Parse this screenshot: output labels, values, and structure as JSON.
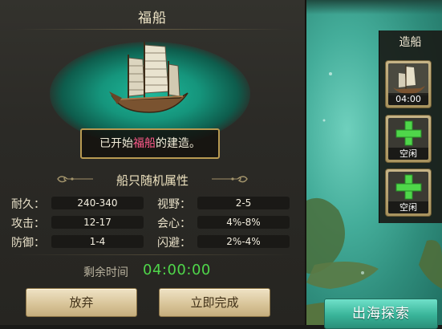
{
  "panel": {
    "title": "福船",
    "build_message": {
      "prefix": "已开始",
      "ship": "福船",
      "suffix": "的建造。"
    },
    "attributes_title": "船只随机属性",
    "attributes": [
      {
        "label": "耐久：",
        "value": "240-340"
      },
      {
        "label": "视野：",
        "value": "2-5"
      },
      {
        "label": "攻击：",
        "value": "12-17"
      },
      {
        "label": "会心：",
        "value": "4%-8%"
      },
      {
        "label": "防御：",
        "value": "1-4"
      },
      {
        "label": "闪避：",
        "value": "2%-4%"
      }
    ],
    "remaining_label": "剩余时间",
    "remaining_time": "04:00:00",
    "give_up_label": "放弃",
    "finish_now_label": "立即完成"
  },
  "shipbuilding": {
    "title": "造船",
    "slots": [
      {
        "type": "ship",
        "label": "04:00"
      },
      {
        "type": "empty",
        "label": "空闲"
      },
      {
        "type": "empty",
        "label": "空闲"
      }
    ]
  },
  "explore_button_label": "出海探索",
  "colors": {
    "highlight_ship": "#ff5a8a",
    "timer_green": "#4fd64a",
    "glow_teal": "#1fb89a",
    "button_gold": "#d9c59a",
    "sea_button": "#39b499"
  },
  "icons": [
    "ship-icon",
    "plus-icon",
    "ornament-icon"
  ]
}
